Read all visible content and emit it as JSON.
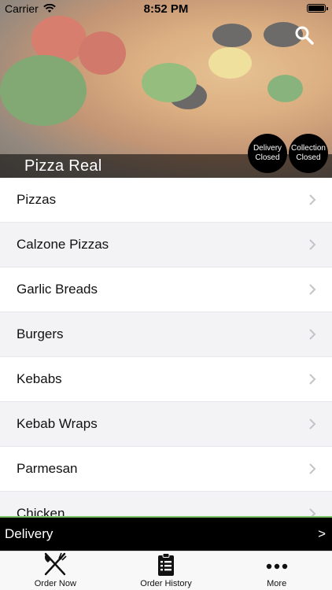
{
  "status_bar": {
    "carrier": "Carrier",
    "time": "8:52 PM"
  },
  "header": {
    "restaurant_name": "Pizza Real",
    "delivery_status": {
      "line1": "Delivery",
      "line2": "Closed"
    },
    "collection_status": {
      "line1": "Collection",
      "line2": "Closed"
    }
  },
  "menu": {
    "items": [
      {
        "label": "Pizzas"
      },
      {
        "label": "Calzone Pizzas"
      },
      {
        "label": "Garlic Breads"
      },
      {
        "label": "Burgers"
      },
      {
        "label": "Kebabs"
      },
      {
        "label": "Kebab Wraps"
      },
      {
        "label": "Parmesan"
      },
      {
        "label": "Chicken"
      }
    ]
  },
  "delivery_bar": {
    "label": "Delivery",
    "arrow": ">"
  },
  "tab_bar": {
    "tabs": [
      {
        "label": "Order Now",
        "icon": "fork-knife-icon"
      },
      {
        "label": "Order History",
        "icon": "clipboard-list-icon"
      },
      {
        "label": "More",
        "icon": "ellipsis-icon"
      }
    ]
  },
  "colors": {
    "accent_line": "#7cc46a",
    "bar_background": "#000000"
  }
}
